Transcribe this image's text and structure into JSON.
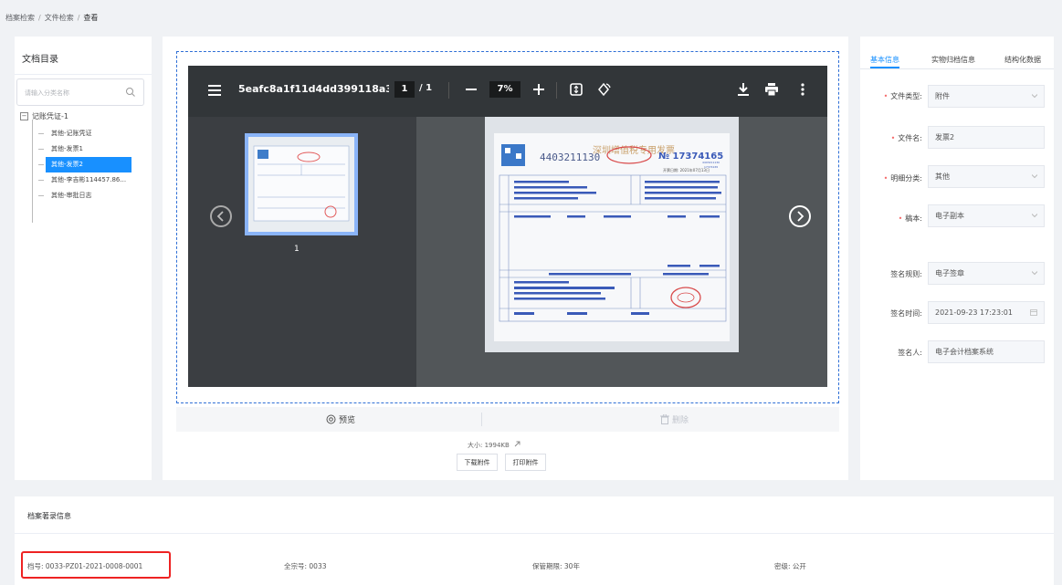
{
  "breadcrumb": {
    "items": [
      "档案检索",
      "文件检索",
      "查看"
    ],
    "separator": "/"
  },
  "left": {
    "title": "文档目录",
    "search_placeholder": "请输入分类名称",
    "tree": {
      "root": "记账凭证-1",
      "root_expander": "−",
      "items": [
        {
          "label": "其他-记账凭证",
          "active": false
        },
        {
          "label": "其他-发票1",
          "active": false
        },
        {
          "label": "其他-发票2",
          "active": true
        },
        {
          "label": "其他-李吉彬114457.86...",
          "active": false
        },
        {
          "label": "其他-审批日志",
          "active": false
        }
      ]
    }
  },
  "viewer": {
    "filename": "5eafc8a1f11d4dd399118a3...",
    "page_current": "1",
    "page_total": "/ 1",
    "zoom": "7%",
    "thumbnail_page": "1",
    "invoice": {
      "code": "4403211130",
      "title": "深圳增值税专用发票",
      "number": "№ 17374165",
      "side_code": "4403211130",
      "side_num": "17374165",
      "date": "开票日期: 2021年07月13日"
    }
  },
  "actions": {
    "preview": "预览",
    "delete": "删除"
  },
  "file": {
    "size": "大小: 1994KB",
    "download": "下载附件",
    "print": "打印附件"
  },
  "right": {
    "tabs": [
      "基本信息",
      "实物归档信息",
      "结构化数据"
    ],
    "fields": [
      {
        "label": "文件类型:",
        "required": true,
        "value": "附件",
        "control": "select"
      },
      {
        "label": "文件名:",
        "required": true,
        "value": "发票2",
        "control": "input"
      },
      {
        "label": "明细分类:",
        "required": true,
        "value": "其他",
        "control": "select"
      },
      {
        "label": "稿本:",
        "required": true,
        "value": "电子副本",
        "control": "select"
      },
      {
        "label": "签名规则:",
        "required": false,
        "value": "电子签章",
        "control": "select"
      },
      {
        "label": "签名时间:",
        "required": false,
        "value": "2021-09-23 17:23:01",
        "control": "date"
      },
      {
        "label": "签名人:",
        "required": false,
        "value": "电子会计档案系统",
        "control": "input"
      }
    ]
  },
  "bottom": {
    "title": "档案著录信息",
    "archive_no": "档号: 0033-PZ01-2021-0008-0001",
    "fonds_no": "全宗号: 0033",
    "retention": "保管期限: 30年",
    "security": "密级: 公开"
  },
  "colors": {
    "accent": "#1890ff",
    "highlight": "#e22222",
    "required": "#f56c6c",
    "viewer_bg": "#525659"
  }
}
